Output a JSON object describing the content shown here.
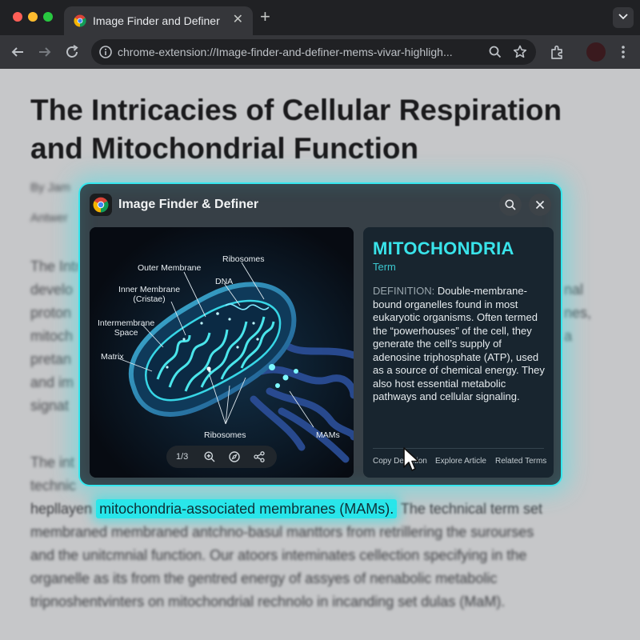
{
  "browser": {
    "tab_title": "Image Finder and Definer",
    "url": "chrome-extension://Image-finder-and-definer-mems-vivar-highligh..."
  },
  "article": {
    "title": "The Intricacies of Cellular Respiration and Mitochondrial Function",
    "byline": "By Jam",
    "meta": "Antwer",
    "para1": [
      "The Intr",
      "develo",
      "proton",
      "mitoch",
      "pretan",
      "and im",
      "signat"
    ],
    "para1_right": [
      "nal",
      "",
      "",
      "nes,",
      "a"
    ],
    "para2_line1": "The int",
    "para2_line2": "technic",
    "highlight_prefix": "hepllayen",
    "highlight_text": "mitochondria-associated membranes (MAMs).",
    "highlight_suffix": "The technical term set",
    "after_lines": [
      "membraned membraned antchno-basul manttors from retrillering the surourses",
      "and the unitcmnial function. Our atoors inteminates cellection specifying in the",
      "organelle as its from the gentred energy of assyes of nenabolic metabolic",
      "tripnoshentvinters on mitochondrial rechnolo in incanding set dulas (MaM)."
    ]
  },
  "overlay": {
    "title": "Image Finder & Definer",
    "image": {
      "labels": {
        "outer_membrane": "Outer Membrane",
        "ribosomes_top": "Ribosomes",
        "dna": "DNA",
        "inner_membrane": "Inner Membrane\n(Cristae)",
        "intermembrane": "Intermembrane\nSpace",
        "matrix": "Matrix",
        "ribosomes_bottom": "Ribosomes",
        "mams": "MAMs"
      },
      "counter": "1/3"
    },
    "definition": {
      "term": "MITOCHONDRIA",
      "kind": "Term",
      "label": "DEFINITION:",
      "text": "Double-membrane-bound organelles found in most eukaryotic organisms. Often termed the “powerhouses” of the cell, they generate the cell’s supply of adenosine triphosphate (ATP), used as a source of chemical energy. They also host essential metabolic pathways and cellular signaling.",
      "actions": [
        "Copy Definition",
        "Explore Article",
        "Related Terms"
      ]
    }
  },
  "colors": {
    "accent": "#35e7ee",
    "highlight": "#29e6ea",
    "term": "#39e3ea"
  }
}
